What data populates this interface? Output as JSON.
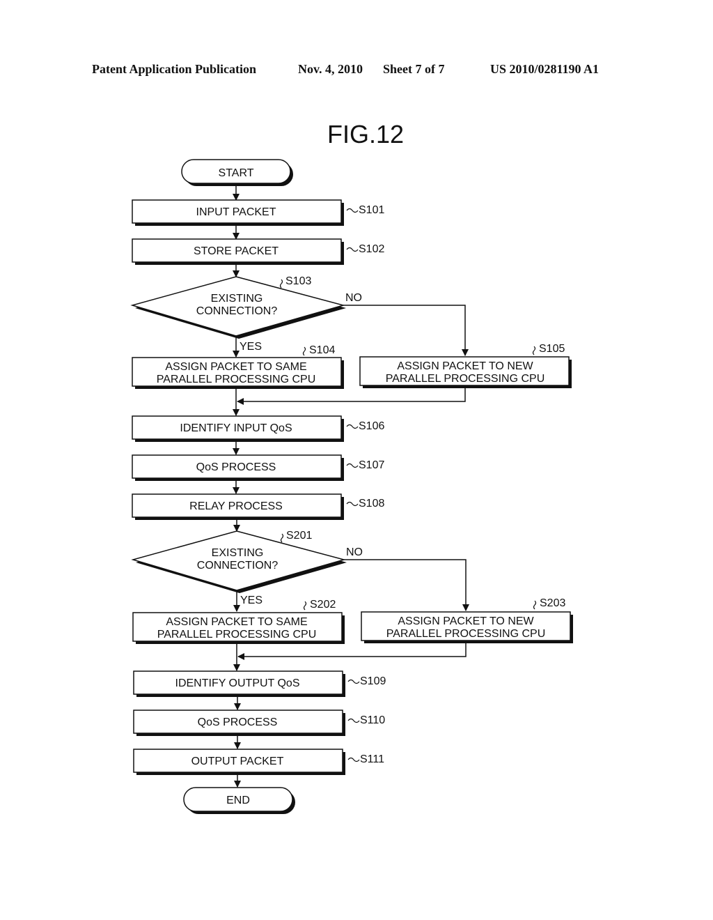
{
  "header": {
    "publication": "Patent Application Publication",
    "date": "Nov. 4, 2010",
    "sheet": "Sheet 7 of 7",
    "number": "US 2010/0281190 A1"
  },
  "figure": {
    "title": "FIG.12"
  },
  "flow": {
    "start": "START",
    "end": "END",
    "yes": "YES",
    "no": "NO",
    "s101": {
      "id": "S101",
      "label": "INPUT PACKET"
    },
    "s102": {
      "id": "S102",
      "label": "STORE PACKET"
    },
    "s103": {
      "id": "S103",
      "line1": "EXISTING",
      "line2": "CONNECTION?"
    },
    "s104": {
      "id": "S104",
      "line1": "ASSIGN PACKET TO SAME",
      "line2": "PARALLEL PROCESSING CPU"
    },
    "s105": {
      "id": "S105",
      "line1": "ASSIGN PACKET TO NEW",
      "line2": "PARALLEL PROCESSING CPU"
    },
    "s106": {
      "id": "S106",
      "label": "IDENTIFY INPUT QoS"
    },
    "s107": {
      "id": "S107",
      "label": "QoS PROCESS"
    },
    "s108": {
      "id": "S108",
      "label": "RELAY PROCESS"
    },
    "s201": {
      "id": "S201",
      "line1": "EXISTING",
      "line2": "CONNECTION?"
    },
    "s202": {
      "id": "S202",
      "line1": "ASSIGN PACKET TO SAME",
      "line2": "PARALLEL PROCESSING CPU"
    },
    "s203": {
      "id": "S203",
      "line1": "ASSIGN PACKET TO NEW",
      "line2": "PARALLEL PROCESSING CPU"
    },
    "s109": {
      "id": "S109",
      "label": "IDENTIFY OUTPUT QoS"
    },
    "s110": {
      "id": "S110",
      "label": "QoS PROCESS"
    },
    "s111": {
      "id": "S111",
      "label": "OUTPUT PACKET"
    }
  }
}
